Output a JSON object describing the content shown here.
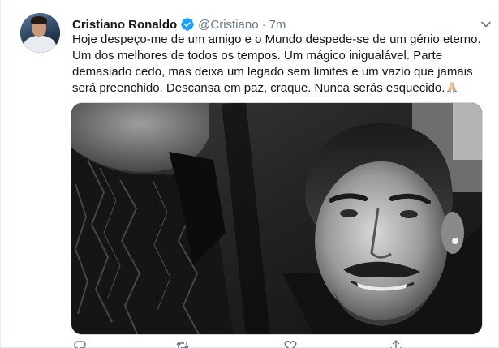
{
  "tweet": {
    "author": {
      "name": "Cristiano Ronaldo",
      "handle": "@Cristiano",
      "verified": true,
      "avatar": "avatar-image"
    },
    "separator": "·",
    "time": "7m",
    "text_lines": [
      "Hoje despeço-me de um amigo e o Mundo despede-se de um génio eterno.",
      "Um dos melhores de todos os tempos. Um mágico inigualável. Parte",
      "demasiado cedo, mas deixa um legado sem limites e um vazio que jamais",
      "será preenchido. Descansa em paz, craque. Nunca serás esquecido."
    ],
    "emoji": "folded-hands-emoji",
    "photo": "black-and-white-photo",
    "icons": {
      "verified": "verified-badge-icon",
      "caret": "chevron-down-icon",
      "reply": "reply-icon",
      "retweet": "retweet-icon",
      "like": "like-icon",
      "share": "share-icon"
    },
    "colors": {
      "brand_blue": "#1da1f2",
      "secondary_text": "#657786",
      "primary_text": "#14171a"
    }
  }
}
